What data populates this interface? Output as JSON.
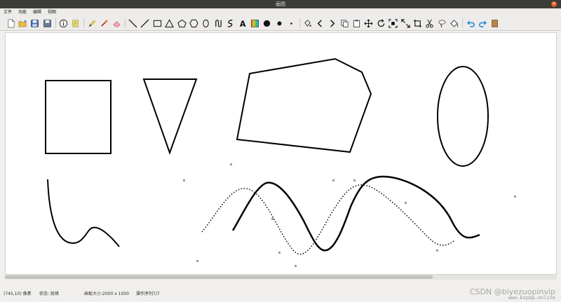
{
  "window": {
    "title": "画图"
  },
  "menu": {
    "items": [
      "文件",
      "功能",
      "编辑",
      "视图"
    ]
  },
  "toolbar": {
    "tools": [
      "new-file-icon",
      "open-folder-icon",
      "save-icon",
      "save-as-icon",
      "info-icon",
      "clear-icon",
      "pen-icon",
      "brush-icon",
      "eraser-icon",
      "line-icon",
      "polyline-icon",
      "rectangle-icon",
      "triangle-icon",
      "pentagon-icon",
      "polygon-icon",
      "ellipse-icon",
      "curve-icon",
      "bezier-icon",
      "text-icon",
      "color-palette-icon",
      "large-dot-icon",
      "medium-dot-icon",
      "small-dot-icon",
      "fill-icon",
      "prev-icon",
      "next-icon",
      "copy-icon",
      "paste-icon",
      "move-icon",
      "rotate-icon",
      "zoom-fit-icon",
      "scale-icon",
      "crop-icon",
      "cut-icon",
      "lasso-icon",
      "bucket-icon",
      "undo-icon",
      "redo-icon",
      "book-icon"
    ],
    "text_tool_label": "A"
  },
  "status": {
    "coords": "(745,10) 像素",
    "state": "状态: 就绪",
    "canvas_size": "画板大小:2000 x 1000",
    "history": "操作序列7/7"
  },
  "watermark": {
    "csdn": "CSDN @biyezuopinvip",
    "site": "www.kspbp.online"
  },
  "colors": {
    "titlebar": "#3b3b37",
    "close_button": "#e95420",
    "undo_arrow": "#2a8fd6",
    "ink": "#000000"
  }
}
